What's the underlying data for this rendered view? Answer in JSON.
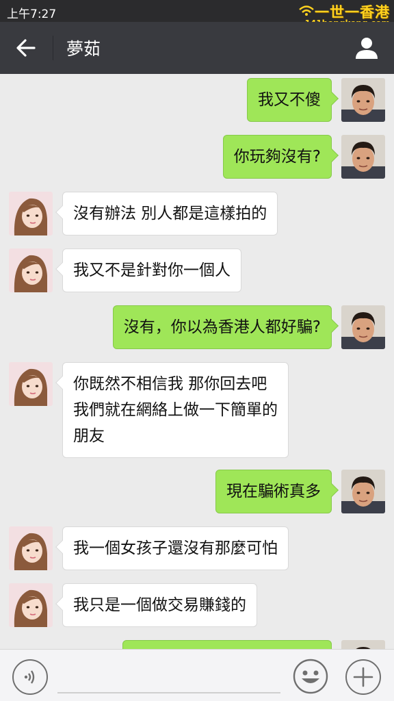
{
  "status_bar": {
    "time": "上午7:27"
  },
  "watermark": {
    "name": "一世一香港",
    "url": "141hongkong.com"
  },
  "header": {
    "title": "夢茹"
  },
  "colors": {
    "accent_green": "#9fe658",
    "header_bg": "#393a3f",
    "chat_bg": "#ebebeb"
  },
  "icons": {
    "back": "arrow-left-icon",
    "profile": "person-icon",
    "voice": "voice-icon",
    "emoji": "smiley-icon",
    "more": "plus-icon"
  },
  "messages": [
    {
      "side": "right",
      "lines": [
        "我又不傻"
      ]
    },
    {
      "side": "right",
      "lines": [
        "你玩夠沒有?"
      ]
    },
    {
      "side": "left",
      "lines": [
        "沒有辦法  別人都是這樣拍的"
      ]
    },
    {
      "side": "left",
      "lines": [
        "我又不是針對你一個人"
      ]
    },
    {
      "side": "right",
      "lines": [
        "沒有，你以為香港人都好騙?"
      ]
    },
    {
      "side": "left",
      "lines": [
        "你既然不相信我  那你回去吧",
        "我們就在網絡上做一下簡單的",
        "朋友"
      ]
    },
    {
      "side": "right",
      "lines": [
        "現在騙術真多"
      ]
    },
    {
      "side": "left",
      "lines": [
        "我一個女孩子還沒有那麼可怕"
      ]
    },
    {
      "side": "left",
      "lines": [
        "我只是一個做交易賺錢的"
      ]
    },
    {
      "side": "right",
      "lines": [
        ""
      ]
    }
  ],
  "input": {
    "value": ""
  }
}
